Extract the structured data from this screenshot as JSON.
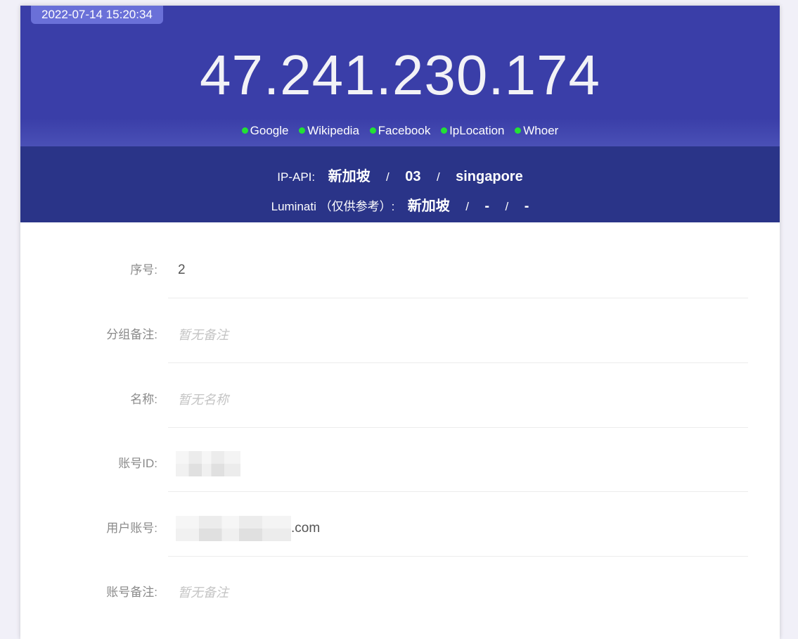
{
  "header": {
    "timestamp": "2022-07-14 15:20:34",
    "ip": "47.241.230.174",
    "links": [
      {
        "label": "Google",
        "dot_color": "#22e234"
      },
      {
        "label": "Wikipedia",
        "dot_color": "#22e234"
      },
      {
        "label": "Facebook",
        "dot_color": "#22e234"
      },
      {
        "label": "IpLocation",
        "dot_color": "#22e234"
      },
      {
        "label": "Whoer",
        "dot_color": "#22e234"
      }
    ]
  },
  "geo": {
    "ipapi": {
      "label": "IP-API:",
      "country": "新加坡",
      "sep1": "/",
      "region": "03",
      "sep2": "/",
      "city": "singapore"
    },
    "luminati": {
      "label": "Luminati （仅供参考）:",
      "country": "新加坡",
      "sep1": "/",
      "region": "-",
      "sep2": "/",
      "city": "-"
    }
  },
  "form": {
    "serial": {
      "label": "序号:",
      "value": "2"
    },
    "group_note": {
      "label": "分组备注:",
      "placeholder": "暂无备注"
    },
    "name": {
      "label": "名称:",
      "placeholder": "暂无名称"
    },
    "account_id": {
      "label": "账号ID:"
    },
    "user_account": {
      "label": "用户账号:",
      "suffix": ".com"
    },
    "account_note": {
      "label": "账号备注:",
      "placeholder": "暂无备注"
    }
  },
  "colors": {
    "header_bg": "#3a3ea8",
    "geo_bg": "#2a3488",
    "timestamp_bg": "#6a70d8",
    "status_green": "#22e234"
  }
}
